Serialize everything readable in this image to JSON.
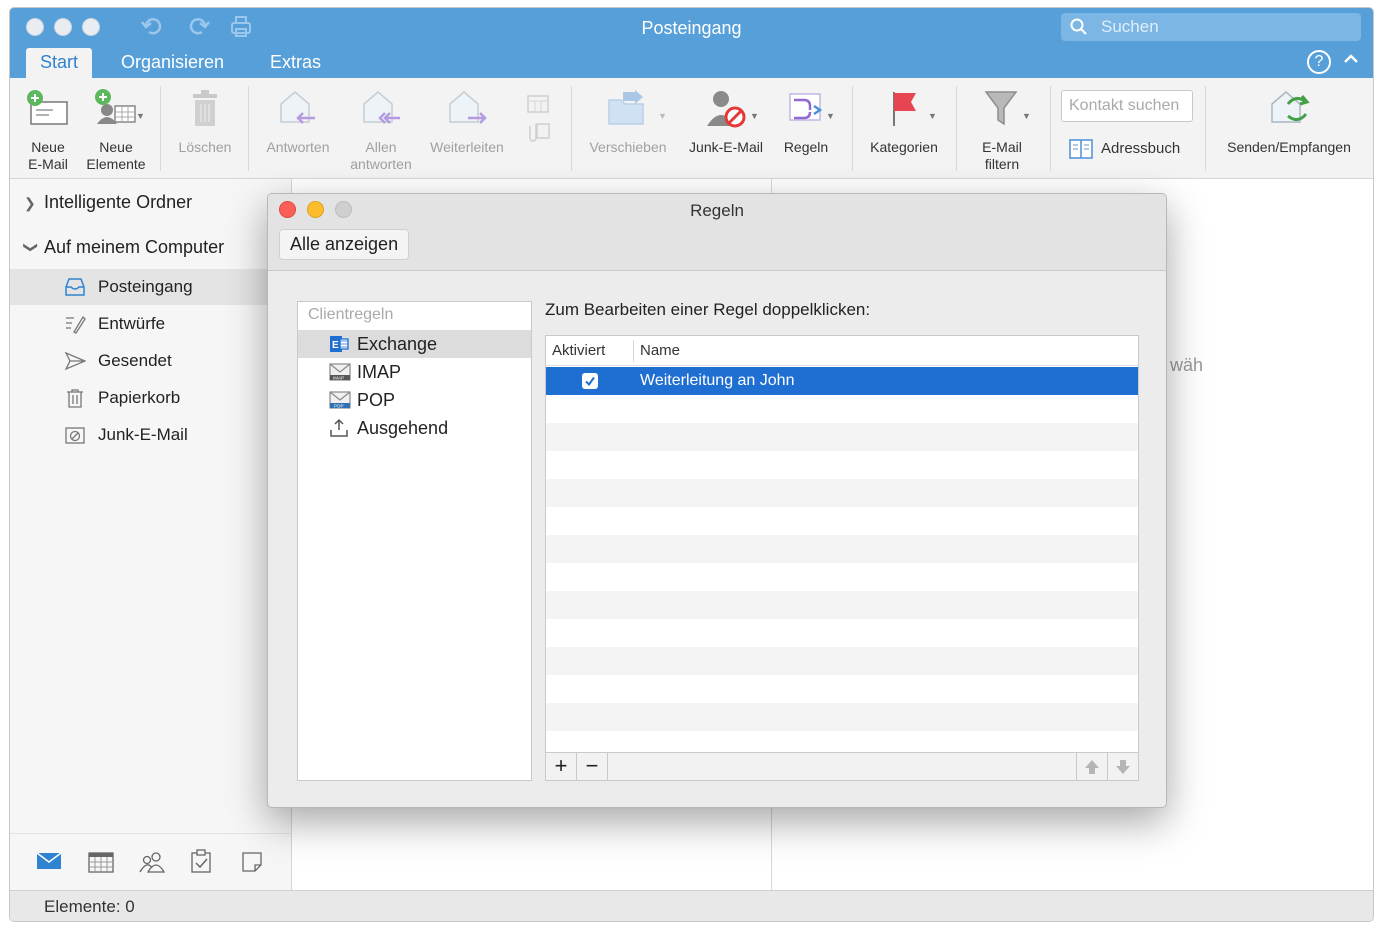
{
  "window": {
    "title": "Posteingang"
  },
  "search": {
    "placeholder": "Suchen"
  },
  "tabs": [
    {
      "label": "Start"
    },
    {
      "label": "Organisieren"
    },
    {
      "label": "Extras"
    }
  ],
  "ribbon": {
    "new_email": "Neue\nE-Mail",
    "new_items": "Neue\nElemente",
    "delete": "Löschen",
    "reply": "Antworten",
    "reply_all": "Allen\nantworten",
    "forward": "Weiterleiten",
    "move": "Verschieben",
    "junk": "Junk-E-Mail",
    "rules": "Regeln",
    "categories": "Kategorien",
    "filter": "E-Mail\nfiltern",
    "contact_search": "Kontakt suchen",
    "address_book": "Adressbuch",
    "send_receive": "Senden/Empfangen"
  },
  "sidebar": {
    "smart_folders": "Intelligente Ordner",
    "on_my_computer": "Auf meinem Computer",
    "items": [
      {
        "label": "Posteingang"
      },
      {
        "label": "Entwürfe"
      },
      {
        "label": "Gesendet"
      },
      {
        "label": "Papierkorb"
      },
      {
        "label": "Junk-E-Mail"
      }
    ]
  },
  "status": {
    "text": "Elemente: 0"
  },
  "background_fragment": "wäh",
  "dialog": {
    "title": "Regeln",
    "show_all": "Alle anzeigen",
    "list_header": "Clientregeln",
    "accounts": [
      {
        "label": "Exchange"
      },
      {
        "label": "IMAP"
      },
      {
        "label": "POP"
      },
      {
        "label": "Ausgehend"
      }
    ],
    "instruction": "Zum Bearbeiten einer Regel doppelklicken:",
    "columns": {
      "enabled": "Aktiviert",
      "name": "Name"
    },
    "rules": [
      {
        "name": "Weiterleitung an John",
        "enabled": true
      }
    ],
    "add_label": "+",
    "remove_label": "−"
  },
  "colors": {
    "titlebar": "#579fd9",
    "accent": "#2f83d0",
    "selection": "#1f6fd3",
    "close": "#fc5f57",
    "minimize": "#fdbc2e"
  }
}
